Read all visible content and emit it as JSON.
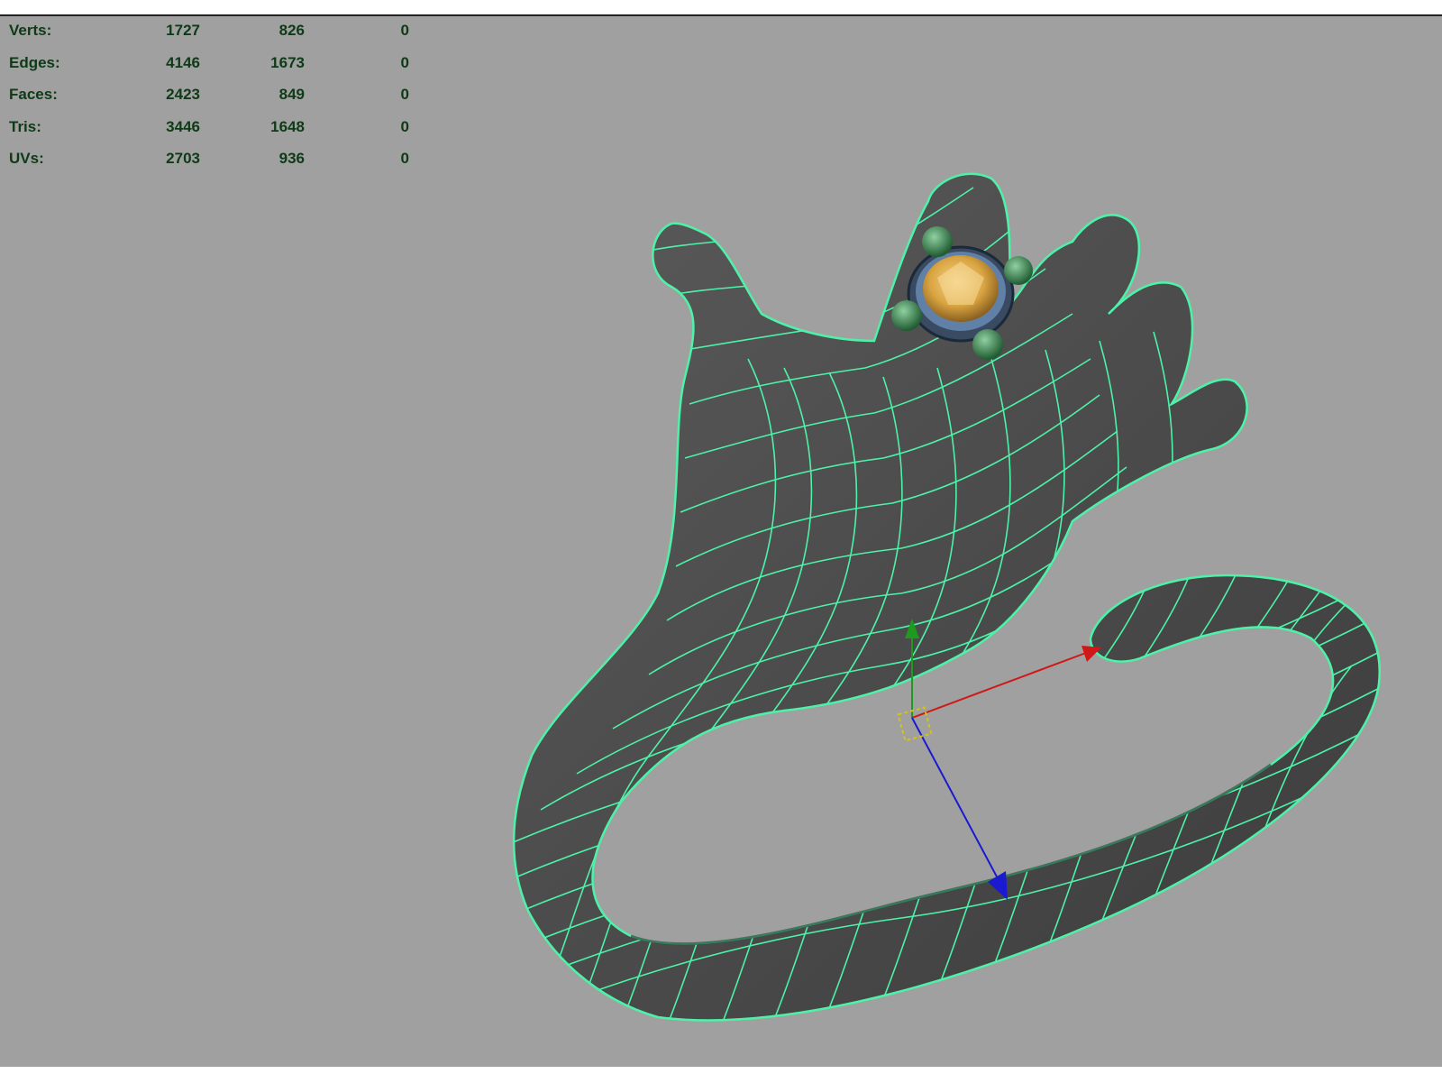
{
  "hud": {
    "rows": [
      {
        "label": "Verts:",
        "values": [
          "1727",
          "826",
          "0"
        ]
      },
      {
        "label": "Edges:",
        "values": [
          "4146",
          "1673",
          "0"
        ]
      },
      {
        "label": "Faces:",
        "values": [
          "2423",
          "849",
          "0"
        ]
      },
      {
        "label": "Tris:",
        "values": [
          "3446",
          "1648",
          "0"
        ]
      },
      {
        "label": "UVs:",
        "values": [
          "2703",
          "936",
          "0"
        ]
      }
    ]
  },
  "colors": {
    "viewport_bg": "#a0a0a0",
    "hud_text": "#0e3a17",
    "wireframe": "#4df2a8",
    "mesh_fill": "#4a4a4a",
    "gem": "#d9a441",
    "axis_x": "#d01818",
    "axis_y": "#1e9a1e",
    "axis_z": "#1a1ad0",
    "pivot": "#d4c21a"
  },
  "icons": [
    "move-manipulator-icon",
    "pivot-handle-icon"
  ]
}
